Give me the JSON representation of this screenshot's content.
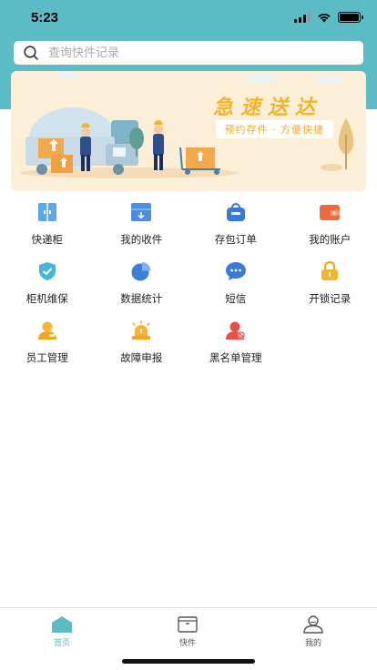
{
  "status": {
    "time": "5:23"
  },
  "search": {
    "placeholder": "查询快件记录"
  },
  "banner": {
    "title": "急速送达",
    "subtitle": "预约存件 · 方便快捷"
  },
  "colors": {
    "primary": "#5bbcc6",
    "banner_bg": "#fcefd8",
    "accent_orange": "#f4b42a"
  },
  "grid": [
    {
      "label": "快递柜",
      "icon": "cabinet-icon"
    },
    {
      "label": "我的收件",
      "icon": "inbox-icon"
    },
    {
      "label": "存包订单",
      "icon": "bag-icon"
    },
    {
      "label": "我的账户",
      "icon": "wallet-icon"
    },
    {
      "label": "柜机维保",
      "icon": "shield-icon"
    },
    {
      "label": "数据统计",
      "icon": "pie-chart-icon"
    },
    {
      "label": "短信",
      "icon": "message-icon"
    },
    {
      "label": "开锁记录",
      "icon": "lock-icon"
    },
    {
      "label": "员工管理",
      "icon": "staff-icon"
    },
    {
      "label": "故障申报",
      "icon": "alarm-icon"
    },
    {
      "label": "黑名单管理",
      "icon": "blacklist-user-icon"
    }
  ],
  "tabs": [
    {
      "label": "首页",
      "icon": "home-icon",
      "active": true
    },
    {
      "label": "快件",
      "icon": "package-box-icon",
      "active": false
    },
    {
      "label": "我的",
      "icon": "user-icon",
      "active": false
    }
  ]
}
